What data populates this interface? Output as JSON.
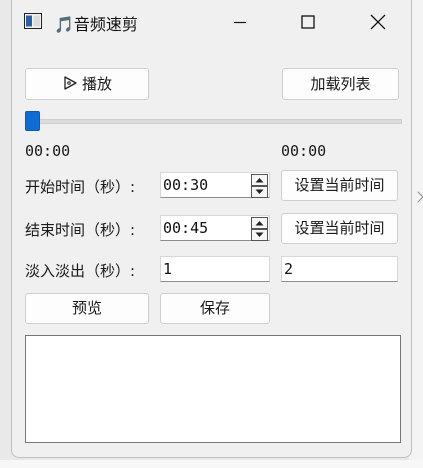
{
  "window": {
    "title": "🎵音频速剪"
  },
  "toolbar": {
    "play_label": "播放",
    "load_list_label": "加载列表"
  },
  "progress": {
    "value": 0,
    "time_current": "00:00",
    "time_total": "00:00"
  },
  "start": {
    "label": "开始时间（秒）:",
    "value": "00:30",
    "set_button": "设置当前时间"
  },
  "end": {
    "label": "结束时间（秒）:",
    "value": "00:45",
    "set_button": "设置当前时间"
  },
  "fade": {
    "label": "淡入淡出（秒）:",
    "fade_in": "1",
    "fade_out": "2"
  },
  "actions": {
    "preview_label": "预览",
    "save_label": "保存"
  },
  "log": {
    "text": ""
  }
}
